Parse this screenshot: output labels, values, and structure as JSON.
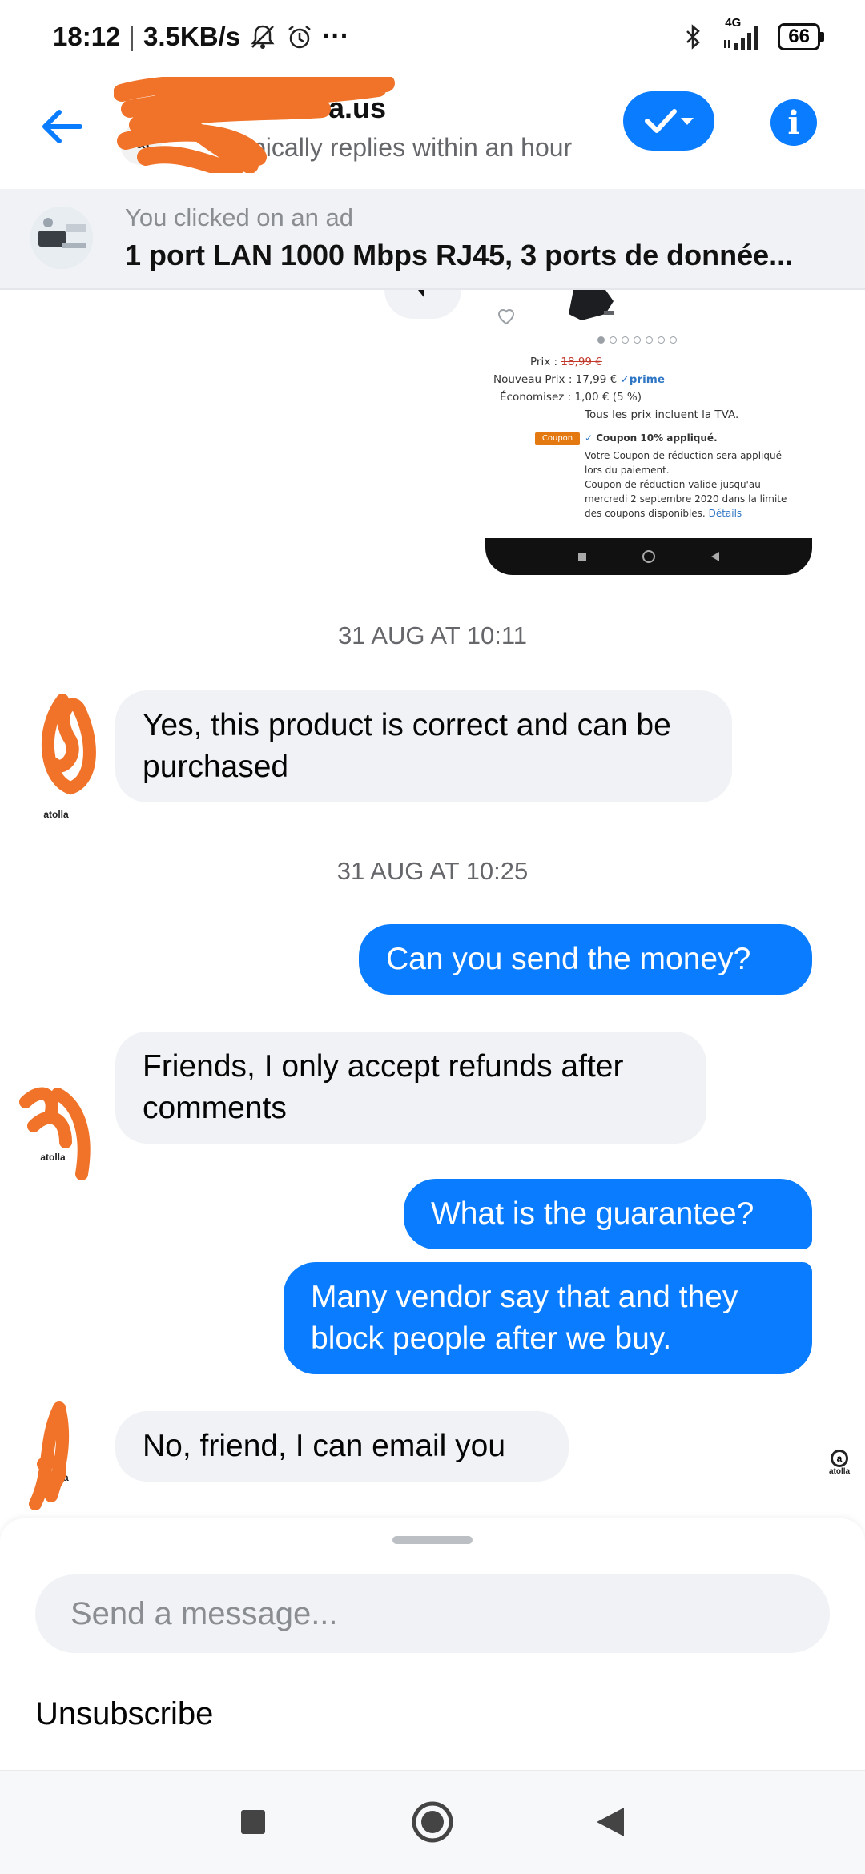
{
  "status_bar": {
    "time": "18:12",
    "speed": "3.5KB/s",
    "overflow_dots": "···",
    "network": "4G",
    "battery": "66",
    "icons": [
      "bell-off-icon",
      "alarm-icon",
      "bluetooth-icon",
      "signal-icon",
      "battery-icon"
    ]
  },
  "header": {
    "contact_name": "a.us",
    "contact_subtitle": "ypically replies within an hour",
    "avatar_text": "at",
    "icons": [
      "back-arrow-icon",
      "checkmark-icon",
      "chevron-down-icon",
      "info-icon"
    ],
    "accent_color": "#0a7cff"
  },
  "ad": {
    "caption": "You clicked on an ad",
    "title": "1 port LAN  1000 Mbps RJ45, 3 ports de donnée..."
  },
  "shared_image": {
    "price_label": "Prix :",
    "old_price": "18,99 €",
    "new_price_label": "Nouveau Prix :",
    "new_price": "17,99 €",
    "prime": "✓prime",
    "savings_label": "Économisez :",
    "savings": "1,00 € (5 %)",
    "tax_note": "Tous les prix incluent la TVA.",
    "coupon_tag": "Coupon",
    "coupon_applied": "Coupon 10% appliqué.",
    "coupon_note_1": "Votre Coupon de réduction sera appliqué",
    "coupon_note_2": "lors du paiement.",
    "coupon_note_3": "Coupon de réduction valide jusqu'au",
    "coupon_note_4": "mercredi 2 septembre 2020 dans la limite",
    "coupon_note_5": "des coupons disponibles.",
    "details_link": "Détails"
  },
  "chat": {
    "timestamp_1": "31 AUG AT 10:11",
    "timestamp_2": "31 AUG AT 10:25",
    "messages": [
      {
        "from": "them",
        "text": "Yes, this product is correct and can be purchased"
      },
      {
        "from": "me",
        "text": "Can you send the money?"
      },
      {
        "from": "them",
        "text": "Friends, I only accept refunds after comments"
      },
      {
        "from": "me",
        "text": "What is the guarantee?"
      },
      {
        "from": "me",
        "text": "Many vendor say that and they block people after we buy."
      },
      {
        "from": "them",
        "text": "No, friend, I can email you"
      }
    ],
    "avatar_label": "atolla",
    "seen_label": "atolla"
  },
  "composer": {
    "placeholder": "Send a message...",
    "unsubscribe": "Unsubscribe"
  },
  "nav": {
    "icons": [
      "recents-square-icon",
      "home-circle-icon",
      "back-triangle-icon"
    ]
  }
}
